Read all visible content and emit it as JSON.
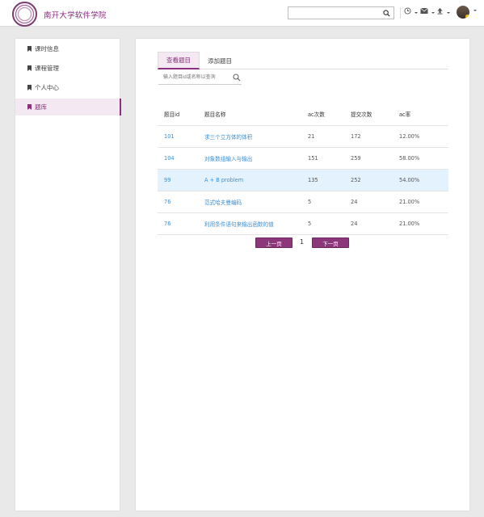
{
  "header": {
    "logo_text": "南开大学软件学院",
    "search_placeholder": "",
    "icons": [
      "clock-icon",
      "mail-icon",
      "upload-icon"
    ]
  },
  "sidebar": {
    "items": [
      {
        "label": "课时信息",
        "active": false
      },
      {
        "label": "课程管理",
        "active": false
      },
      {
        "label": "个人中心",
        "active": false
      },
      {
        "label": "题库",
        "active": true
      }
    ]
  },
  "main": {
    "tabs": [
      {
        "label": "查看题目",
        "active": true
      },
      {
        "label": "添加题目",
        "active": false
      }
    ],
    "filter_placeholder": "输入题目id或名称以查询",
    "table": {
      "headers": [
        "题目id",
        "题目名称",
        "ac次数",
        "提交次数",
        "ac率"
      ],
      "rows": [
        [
          "101",
          "求三个立方体的体积",
          "21",
          "172",
          "12.00%"
        ],
        [
          "104",
          "对象数组输入与输出",
          "151",
          "259",
          "58.00%"
        ],
        [
          "99",
          "A + B problem",
          "135",
          "252",
          "54.00%"
        ],
        [
          "76",
          "范式哈夫曼编码",
          "5",
          "24",
          "21.00%"
        ],
        [
          "76",
          "利用条件语句来输出函数的值",
          "5",
          "24",
          "21.00%"
        ]
      ]
    },
    "pager": {
      "prev": "上一页",
      "page": "1",
      "next": "下一页"
    }
  },
  "colors": {
    "brand": "#8b2f7f",
    "link": "#3d8fd1",
    "highlight_row": "#e4f2fd"
  }
}
